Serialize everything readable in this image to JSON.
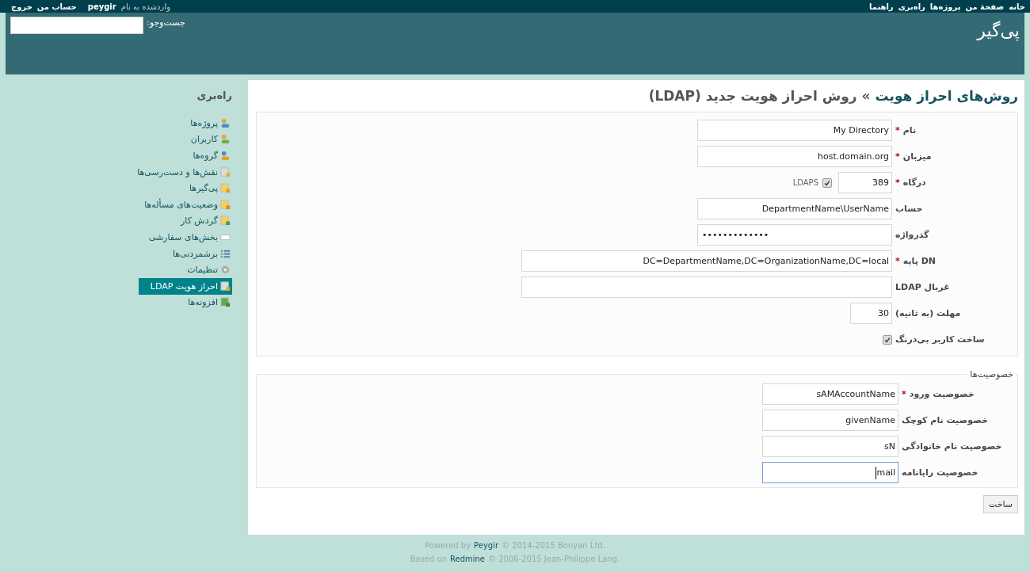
{
  "top_menu": {
    "main": [
      "خانه",
      "صفحهٔ من",
      "پروژه‌ها",
      "راه‌بری",
      "راهنما"
    ],
    "logged_as": "واردشده به نام",
    "user": "peygir",
    "account": [
      "حساب من",
      "خروج"
    ]
  },
  "header": {
    "title": "پی‌گیر",
    "search_label": "جست‌وجو:"
  },
  "sidebar": {
    "title": "راه‌بری",
    "items": [
      {
        "label": "پروژه‌ها",
        "selected": false
      },
      {
        "label": "کاربران",
        "selected": false
      },
      {
        "label": "گروه‌ها",
        "selected": false
      },
      {
        "label": "نقش‌ها و دست‌رسی‌ها",
        "selected": false
      },
      {
        "label": "پی‌گیرها",
        "selected": false
      },
      {
        "label": "وضعیت‌های مسأله‌ها",
        "selected": false
      },
      {
        "label": "گردش کار",
        "selected": false
      },
      {
        "label": "بخش‌های سفارشی",
        "selected": false
      },
      {
        "label": "برشمردنی‌ها",
        "selected": false
      },
      {
        "label": "تنظیمات",
        "selected": false
      },
      {
        "label": "احراز هویت LDAP",
        "selected": true
      },
      {
        "label": "افزونه‌ها",
        "selected": false
      }
    ]
  },
  "title": {
    "link": "روش‌های احراز هویت",
    "rest": "» روش احراز هویت جدید (LDAP)"
  },
  "fields": [
    {
      "label": "نام",
      "kind": "text",
      "required": true,
      "value": "My Directory"
    },
    {
      "label": "میزبان",
      "kind": "text",
      "required": true,
      "value": "host.domain.org"
    },
    {
      "label": "درگاه",
      "kind": "port",
      "required": true,
      "value": "389",
      "extra": {
        "label": "LDAPS",
        "checked": true
      }
    },
    {
      "label": "حساب",
      "kind": "text",
      "required": false,
      "value": "DepartmentName\\UserName"
    },
    {
      "label": "گذرواژه",
      "kind": "password",
      "required": false,
      "value": "•••••••••••••"
    },
    {
      "label": "DN پایه",
      "kind": "wide",
      "required": true,
      "value": "DC=DepartmentName,DC=OrganizationName,DC=local"
    },
    {
      "label": "غربال LDAP",
      "kind": "wide",
      "required": false
    },
    {
      "label": "مهلت (به ثانیه)",
      "kind": "number",
      "required": false,
      "value": "30"
    },
    {
      "label": "ساخت کاربر بی‌درنگ",
      "kind": "checkbox",
      "required": false,
      "checked": true
    }
  ],
  "attributes": {
    "legend": "خصوصیت‌ها",
    "fields": [
      {
        "label": "خصوصیت ورود",
        "required": true,
        "value": "sAMAccountName",
        "focused": false
      },
      {
        "label": "خصوصیت نام کوچک",
        "required": false,
        "value": "givenName",
        "focused": false
      },
      {
        "label": "خصوصیت نام خانوادگی",
        "required": false,
        "value": "sN",
        "focused": false
      },
      {
        "label": "خصوصیت رایانامه",
        "required": false,
        "value": "mail",
        "focused": true
      }
    ]
  },
  "required_mark": "*",
  "submit": "ساخت",
  "footer": [
    {
      "before": "Powered by",
      "link": "Peygir",
      "after": "© 2014-2015 Bonyan Ltd."
    },
    {
      "before": "Based on",
      "link": "Redmine",
      "after": "© 2006-2015 Jean-Philippe Lang."
    }
  ]
}
